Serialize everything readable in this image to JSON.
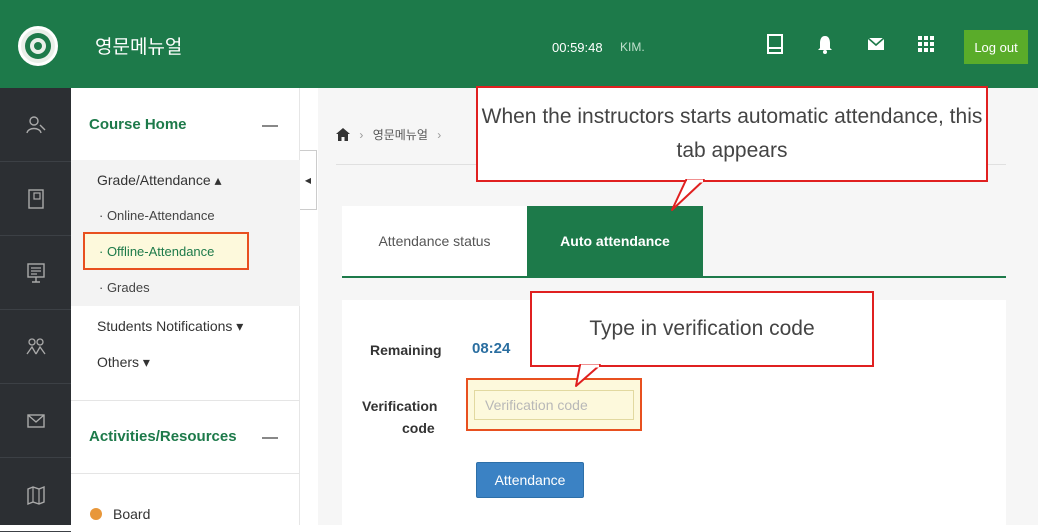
{
  "header": {
    "app_title": "영문메뉴얼",
    "clock": "00:59:48",
    "user": "KIM.",
    "logout_label": "Log out",
    "icons": [
      "tablet-icon",
      "bell-icon",
      "mail-icon",
      "apps-grid-icon"
    ]
  },
  "rail": {
    "icons": [
      "user-profile-icon",
      "notebook-icon",
      "presentation-icon",
      "group-icon",
      "envelope-icon",
      "map-icon"
    ]
  },
  "sidebar": {
    "course_home": "Course Home",
    "grade_attendance": "Grade/Attendance ▴",
    "online_attendance": "· Online-Attendance",
    "offline_attendance": "· Offline-Attendance",
    "grades": "· Grades",
    "students_notifications": "Students Notifications ▾",
    "others": "Others ▾",
    "activities_resources": "Activities/Resources",
    "board": "Board"
  },
  "breadcrumb": {
    "item1": "영문메뉴얼",
    "sep": "›"
  },
  "tabs": {
    "status": "Attendance status",
    "auto": "Auto attendance"
  },
  "form": {
    "remaining_label": "Remaining",
    "remaining_value": "08:24",
    "verification_label_1": "Verification",
    "verification_label_2": "code",
    "verification_placeholder": "Verification code",
    "attendance_button": "Attendance"
  },
  "callouts": {
    "tab_note": "When the instructors starts automatic attendance, this tab appears",
    "code_note": "Type in verification code"
  },
  "colors": {
    "brand_green": "#1d7a4a",
    "logout_green": "#5aac2a",
    "highlight_orange": "#e8501f",
    "callout_red": "#e02020",
    "button_blue": "#3b82c4"
  }
}
